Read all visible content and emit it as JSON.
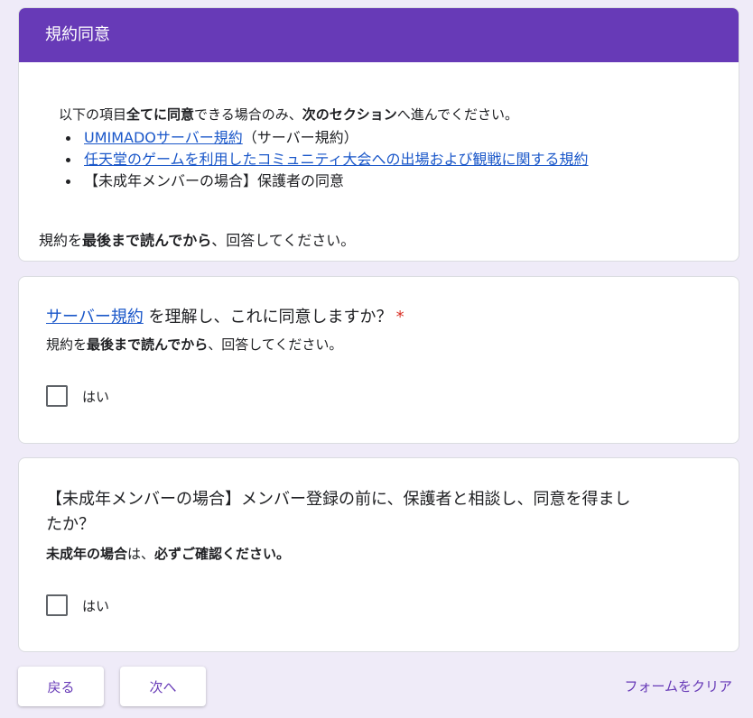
{
  "section": {
    "title": "規約同意",
    "intro": [
      {
        "t": "以下の項目",
        "b": false
      },
      {
        "t": "全てに同意",
        "b": true
      },
      {
        "t": "できる場合のみ、",
        "b": false
      },
      {
        "t": "次のセクション",
        "b": true
      },
      {
        "t": "へ進んでください。",
        "b": false
      }
    ],
    "rules": [
      {
        "link": "UMIMADOサーバー規約",
        "suffix": "（サーバー規約）"
      },
      {
        "link": "任天堂のゲームを利用したコミュニティ大会への出場および観戦に関する規約",
        "suffix": ""
      },
      {
        "link": "",
        "suffix": "【未成年メンバーの場合】保護者の同意"
      }
    ],
    "footnote": [
      {
        "t": "規約を",
        "b": false
      },
      {
        "t": "最後まで読んでから",
        "b": true
      },
      {
        "t": "、回答してください。",
        "b": false
      }
    ]
  },
  "question1": {
    "title_link": "サーバー規約",
    "title_rest": " を理解し、これに同意しますか？",
    "required_mark": "*",
    "description": [
      {
        "t": "規約を",
        "b": false
      },
      {
        "t": "最後まで読んでから",
        "b": true
      },
      {
        "t": "、回答してください。",
        "b": false
      }
    ],
    "option_label": "はい",
    "checked": false
  },
  "question2": {
    "title_line1": "【未成年メンバーの場合】メンバー登録の前に、保護者と相談し、同意を得まし",
    "title_line2": "たか？",
    "description": [
      {
        "t": "未成年の場合",
        "b": true
      },
      {
        "t": "は、",
        "b": false
      },
      {
        "t": "必ずご確認ください。",
        "b": true
      }
    ],
    "option_label": "はい",
    "checked": false
  },
  "navigation": {
    "back_label": "戻る",
    "next_label": "次へ",
    "clear_label": "フォームをクリア"
  },
  "colors": {
    "accent": "#673ab7",
    "background": "#efebf8",
    "link": "#1a57c9",
    "required": "#d93025"
  }
}
